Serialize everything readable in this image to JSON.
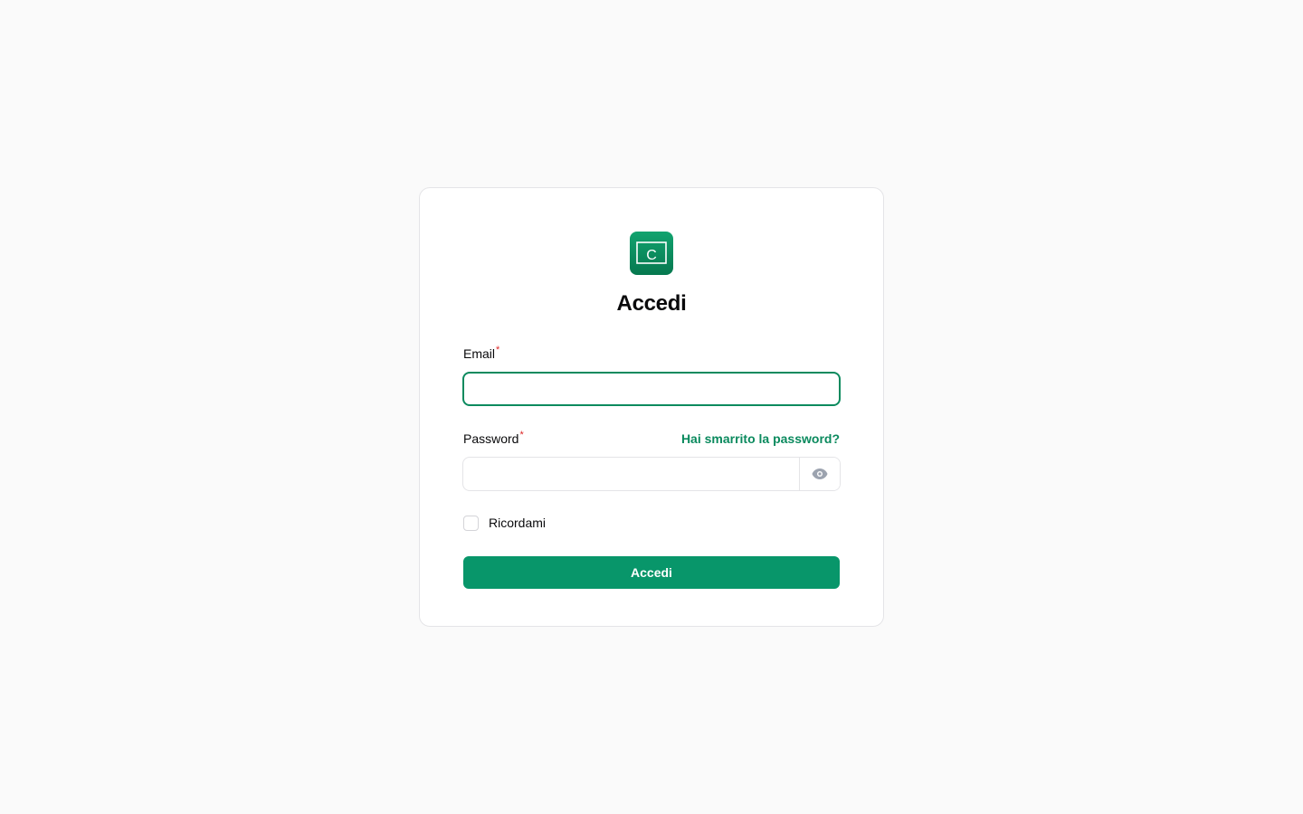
{
  "brand": {
    "logo_letter": "C",
    "accent_color": "#08966a"
  },
  "form": {
    "title": "Accedi",
    "email": {
      "label": "Email",
      "required_marker": "*",
      "value": "",
      "placeholder": ""
    },
    "password": {
      "label": "Password",
      "required_marker": "*",
      "value": "",
      "placeholder": "",
      "forgot_link": "Hai smarrito la password?",
      "toggle_icon": "eye-icon"
    },
    "remember": {
      "label": "Ricordami",
      "checked": false
    },
    "submit_label": "Accedi"
  }
}
